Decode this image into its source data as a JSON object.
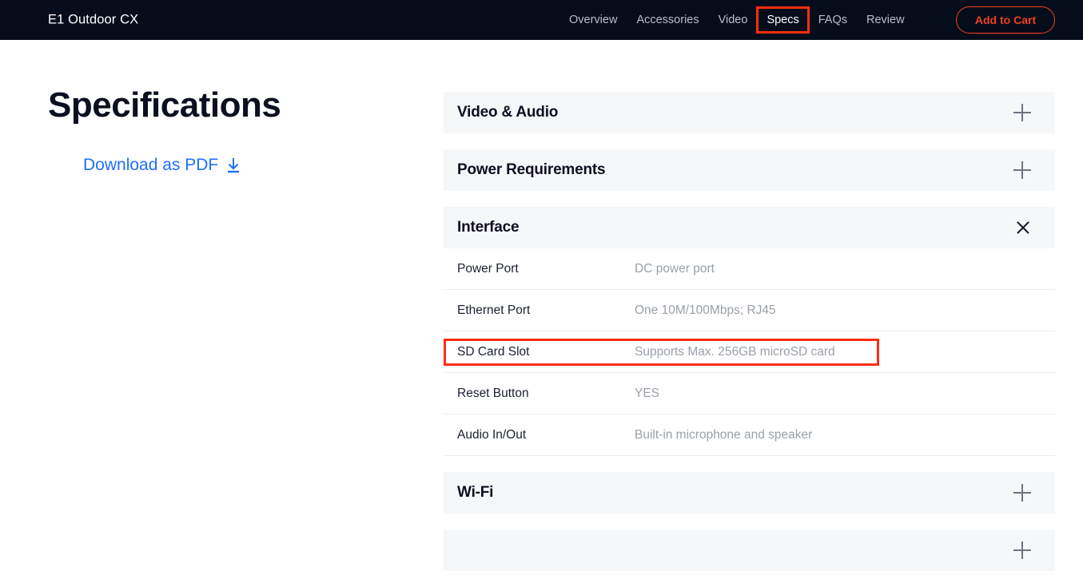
{
  "header": {
    "brand": "E1 Outdoor CX",
    "nav": [
      {
        "label": "Overview",
        "active": false,
        "highlighted": false
      },
      {
        "label": "Accessories",
        "active": false,
        "highlighted": false
      },
      {
        "label": "Video",
        "active": false,
        "highlighted": false
      },
      {
        "label": "Specs",
        "active": true,
        "highlighted": true
      },
      {
        "label": "FAQs",
        "active": false,
        "highlighted": false
      },
      {
        "label": "Review",
        "active": false,
        "highlighted": false
      }
    ],
    "cart_button": "Add to Cart",
    "bar_color": "#060d1a",
    "accent_color": "#f0411d",
    "highlight_color": "#ff2d10"
  },
  "left": {
    "page_title": "Specifications",
    "pdf_link": "Download as PDF",
    "pdf_link_color": "#1f6fff",
    "download_icon": "download-arrow-icon"
  },
  "accordion": {
    "sections": [
      {
        "title": "Video & Audio",
        "expanded": false,
        "toggle_icon": "plus-icon",
        "rows": []
      },
      {
        "title": "Power Requirements",
        "expanded": false,
        "toggle_icon": "plus-icon",
        "rows": []
      },
      {
        "title": "Interface",
        "expanded": true,
        "toggle_icon": "close-icon",
        "rows": [
          {
            "label": "Power Port",
            "value": "DC power port",
            "highlighted": false
          },
          {
            "label": "Ethernet Port",
            "value": "One 10M/100Mbps; RJ45",
            "highlighted": false
          },
          {
            "label": "SD Card Slot",
            "value": "Supports Max. 256GB microSD card",
            "highlighted": true
          },
          {
            "label": "Reset Button",
            "value": "YES",
            "highlighted": false
          },
          {
            "label": "Audio In/Out",
            "value": "Built-in microphone and speaker",
            "highlighted": false
          }
        ]
      },
      {
        "title": "Wi-Fi",
        "expanded": false,
        "toggle_icon": "plus-icon",
        "rows": []
      },
      {
        "title": "",
        "expanded": false,
        "toggle_icon": "plus-icon",
        "rows": []
      }
    ]
  }
}
